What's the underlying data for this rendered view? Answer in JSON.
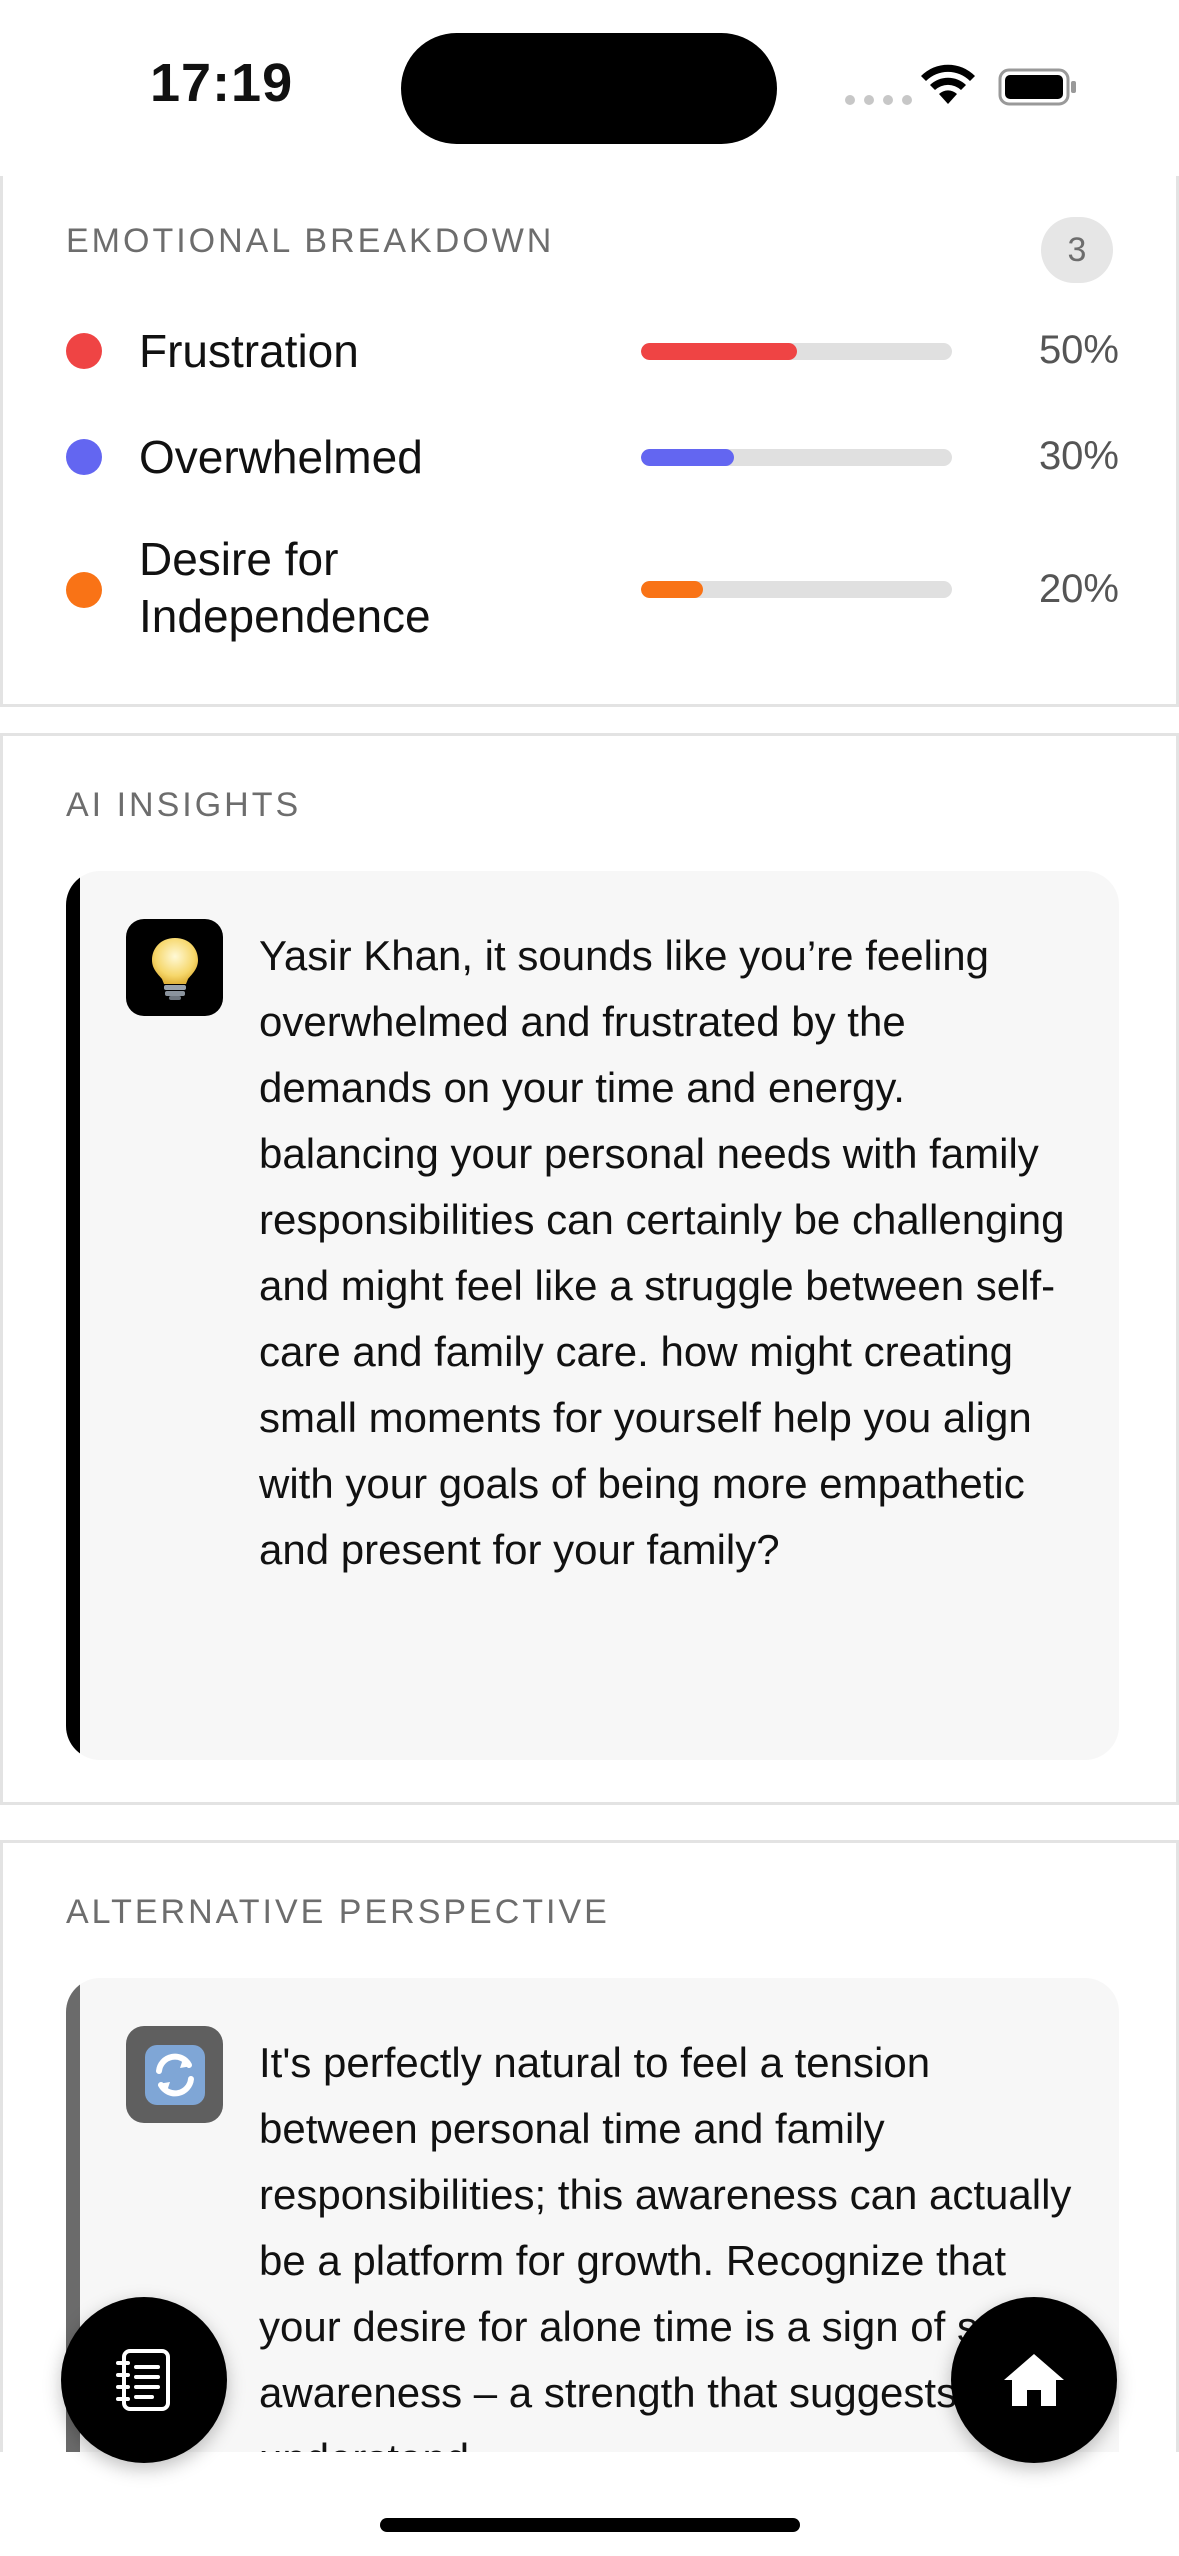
{
  "status_bar": {
    "time": "17:19"
  },
  "emotional_breakdown": {
    "title": "EMOTIONAL BREAKDOWN",
    "count": "3",
    "items": [
      {
        "label": "Frustration",
        "percent_text": "50%",
        "percent": 50,
        "color": "#EF4444"
      },
      {
        "label": "Overwhelmed",
        "percent_text": "30%",
        "percent": 30,
        "color": "#6366F1"
      },
      {
        "label": "Desire for Independence",
        "percent_text": "20%",
        "percent": 20,
        "color": "#F97316"
      }
    ]
  },
  "ai_insights": {
    "title": "AI INSIGHTS",
    "icon": "lightbulb-icon",
    "accent": "#000000",
    "text": "Yasir Khan, it sounds like you’re feeling overwhelmed and frustrated by the demands on your time and energy. balancing your personal needs with family responsibilities can certainly be challenging and might feel like a struggle between self-care and family care. how might creating small moments for yourself help you align with your goals of being more empathetic and present for your family?"
  },
  "alternative_perspective": {
    "title": "ALTERNATIVE PERSPECTIVE",
    "icon": "refresh-icon",
    "accent": "#6B6B6B",
    "text": "It's perfectly natural to feel a tension between personal time and family responsibilities; this awareness can actually be a platform for growth. Recognize that your desire for alone time is a sign of self-awareness – a strength that suggests you understand"
  },
  "floating_buttons": {
    "left": "journal-icon",
    "right": "home-icon"
  }
}
